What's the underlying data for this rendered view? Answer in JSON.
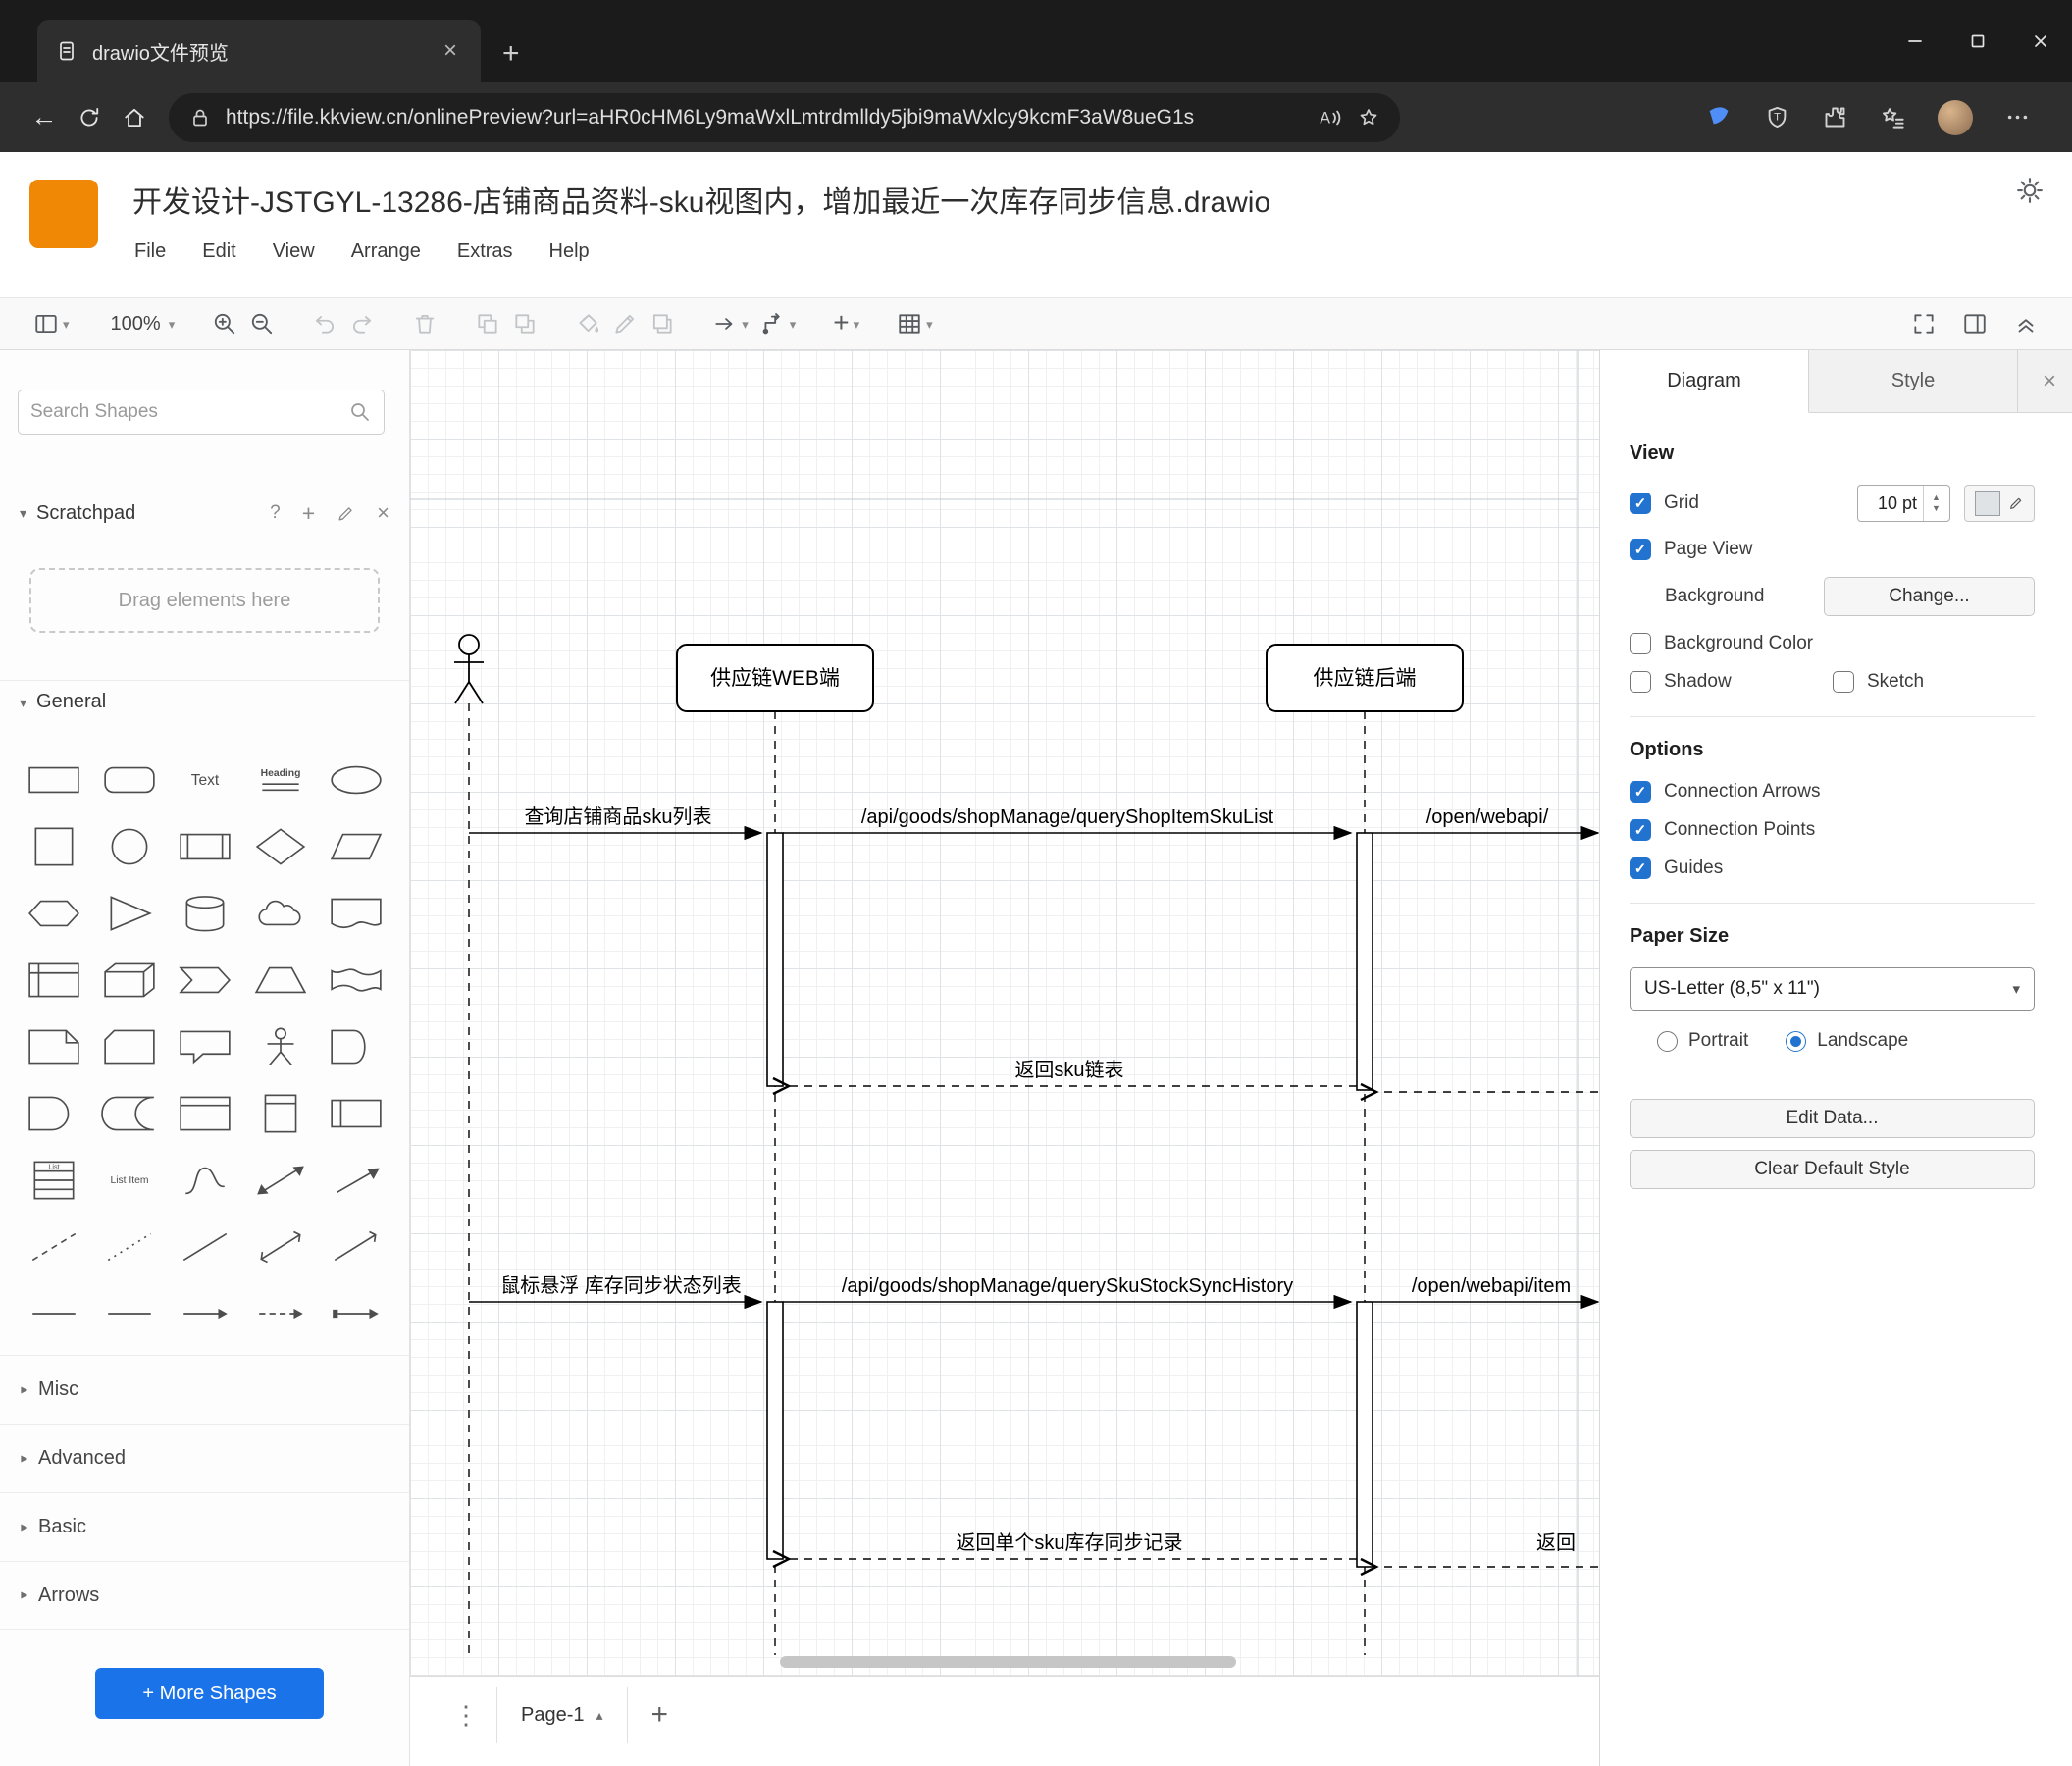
{
  "colors": {
    "drawio_orange": "#f08705",
    "more_shapes_blue": "#1a73e8",
    "checkbox_blue": "#2273cf"
  },
  "icons": {
    "caret_down": "▾",
    "chevron_up": "▴",
    "close": "×",
    "plus": "+",
    "question": "?",
    "dots_vertical": "⋮",
    "back_arrow": "←",
    "read_aloud_letter": "A"
  },
  "browser": {
    "tab_title": "drawio文件预览",
    "url": "https://file.kkview.cn/onlinePreview?url=aHR0cHM6Ly9maWxlLmtrdmlldy5jbi9maWxlcy9kcmF3aW8ueG1s"
  },
  "app": {
    "file_title": "开发设计-JSTGYL-13286-店铺商品资料-sku视图内，增加最近一次库存同步信息.drawio",
    "menu": [
      "File",
      "Edit",
      "View",
      "Arrange",
      "Extras",
      "Help"
    ],
    "zoom_level": "100%"
  },
  "sidebar": {
    "search_placeholder": "Search Shapes",
    "scratchpad_label": "Scratchpad",
    "drop_hint": "Drag elements here",
    "general_label": "General",
    "sections": [
      "Misc",
      "Advanced",
      "Basic",
      "Arrows"
    ],
    "more_shapes_label": "+ More Shapes",
    "icon_labels": {
      "text": "Text",
      "heading": "Heading",
      "list": "List",
      "list_item": "List Item"
    },
    "general_shapes": [
      "rectangle",
      "rounded-rectangle",
      "text",
      "heading",
      "ellipse",
      "square",
      "circle",
      "process",
      "diamond",
      "parallelogram",
      "hexagon",
      "triangle",
      "cylinder",
      "cloud",
      "document",
      "internal-storage",
      "cube",
      "step",
      "trapezoid",
      "tape",
      "note",
      "card",
      "callout",
      "actor",
      "or",
      "and",
      "data-storage",
      "container",
      "vertical-container",
      "horizontal-container",
      "list",
      "list-item",
      "curve",
      "bidirectional-arrow",
      "arrow",
      "dashed-line",
      "dotted-line",
      "line",
      "bidirectional-connector",
      "directional-connector",
      "link",
      "horizontal-line",
      "horizontal-arrow",
      "horizontal-directional",
      "horizontal-connector"
    ]
  },
  "diagram": {
    "lifeline_web": "供应链WEB端",
    "lifeline_backend": "供应链后端",
    "msg_query_sku_list": "查询店铺商品sku列表",
    "msg_api_query_shop_item_sku_list": "/api/goods/shopManage/queryShopItemSkuList",
    "msg_open_webapi": "/open/webapi/",
    "msg_return_sku_list": "返回sku链表",
    "msg_hover_stock_sync": "鼠标悬浮 库存同步状态列表",
    "msg_api_query_sku_stock_sync_history": "/api/goods/shopManage/querySkuStockSyncHistory",
    "msg_open_webapi_item": "/open/webapi/item",
    "msg_return_single_sku_record": "返回单个sku库存同步记录",
    "msg_return_partial": "返回"
  },
  "format": {
    "tab_diagram": "Diagram",
    "tab_style": "Style",
    "view_label": "View",
    "grid_label": "Grid",
    "grid_size": "10 pt",
    "page_view_label": "Page View",
    "background_label": "Background",
    "change_button": "Change...",
    "background_color_label": "Background Color",
    "shadow_label": "Shadow",
    "sketch_label": "Sketch",
    "options_label": "Options",
    "connection_arrows_label": "Connection Arrows",
    "connection_points_label": "Connection Points",
    "guides_label": "Guides",
    "paper_size_label": "Paper Size",
    "paper_size_value": "US-Letter (8,5\" x 11\")",
    "portrait_label": "Portrait",
    "landscape_label": "Landscape",
    "edit_data_button": "Edit Data...",
    "clear_default_style_button": "Clear Default Style"
  },
  "footer": {
    "page_name": "Page-1"
  }
}
